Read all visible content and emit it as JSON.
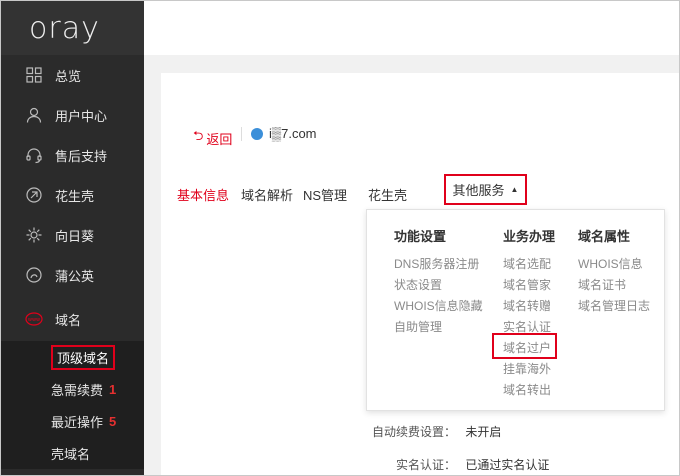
{
  "logo": "oray",
  "sidebar": {
    "items": [
      {
        "label": "总览",
        "icon": "grid-icon"
      },
      {
        "label": "用户中心",
        "icon": "user-icon"
      },
      {
        "label": "售后支持",
        "icon": "support-icon"
      },
      {
        "label": "花生壳",
        "icon": "peanut-icon"
      },
      {
        "label": "向日葵",
        "icon": "sunflower-icon"
      },
      {
        "label": "蒲公英",
        "icon": "dandelion-icon"
      },
      {
        "label": "域名",
        "icon": "www-icon"
      }
    ],
    "sub_items": [
      {
        "label": "顶级域名",
        "badge": ""
      },
      {
        "label": "急需续费",
        "badge": "1"
      },
      {
        "label": "最近操作",
        "badge": "5"
      },
      {
        "label": "壳域名",
        "badge": ""
      }
    ]
  },
  "header": {
    "back_label": "返回",
    "domain": "i▒7.com"
  },
  "tabs": [
    "基本信息",
    "域名解析",
    "NS管理",
    "花生壳",
    "其他服务"
  ],
  "dropdown": {
    "columns": [
      {
        "title": "功能设置",
        "items": [
          "DNS服务器注册",
          "状态设置",
          "WHOIS信息隐藏",
          "自助管理"
        ]
      },
      {
        "title": "业务办理",
        "items": [
          "域名选配",
          "域名管家",
          "域名转赠",
          "实名认证",
          "域名过户",
          "挂靠海外",
          "域名转出"
        ]
      },
      {
        "title": "域名属性",
        "items": [
          "WHOIS信息",
          "域名证书",
          "域名管理日志"
        ]
      }
    ]
  },
  "info": {
    "auto_renew_label": "自动续费设置：",
    "auto_renew_value": "未开启",
    "realname_label": "实名认证：",
    "realname_value": "已通过实名认证"
  },
  "colors": {
    "accent": "#e0001b",
    "sidebar": "#2b2b2b"
  }
}
